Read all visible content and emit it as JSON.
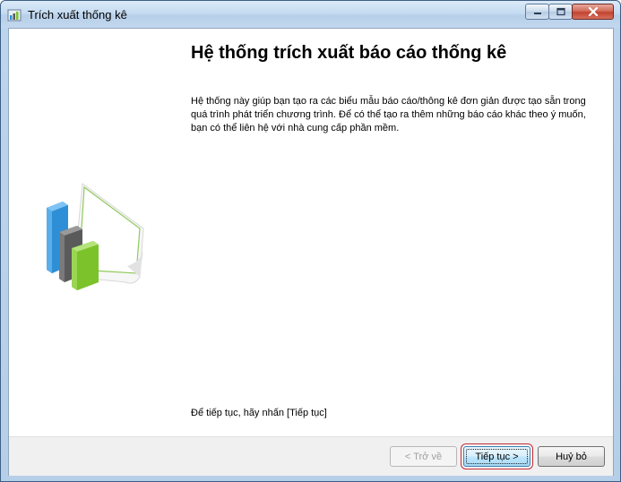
{
  "window": {
    "title": "Trích xuất thống kê",
    "controls": {
      "minimize_icon": "minimize-icon",
      "maximize_icon": "maximize-icon",
      "close_icon": "close-icon"
    }
  },
  "main": {
    "heading": "Hệ thống trích xuất báo cáo thống kê",
    "description": "Hệ thống này giúp bạn tạo ra các biểu mẫu báo cáo/thông kê đơn giản được tạo sẵn trong quá trình phát triển chương trình. Để có thể tạo ra thêm những báo cáo khác theo ý muốn, bạn có thể liên hệ với nhà cung cấp phần mềm.",
    "continue_hint": "Để tiếp tục, hãy nhấn [Tiếp tục]",
    "illustration_icon": "bar-chart-icon"
  },
  "footer": {
    "back_label": "< Trở về",
    "next_label": "Tiếp tục >",
    "cancel_label": "Huỷ bỏ"
  },
  "colors": {
    "highlight_border": "#c0272d",
    "bar_blue": "#2f8fd6",
    "bar_gray": "#5a5a5a",
    "bar_green": "#7cc22a"
  }
}
